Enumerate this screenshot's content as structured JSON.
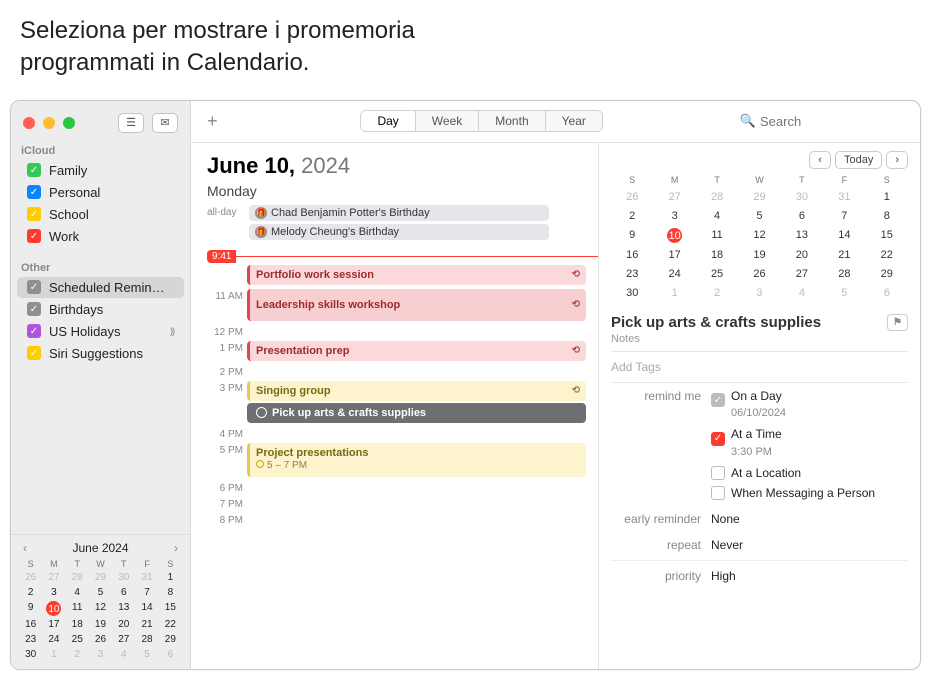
{
  "caption": "Seleziona per mostrare i promemoria programmati in Calendario.",
  "toolbar": {
    "plus": "+",
    "views": [
      "Day",
      "Week",
      "Month",
      "Year"
    ],
    "active_view": "Day",
    "search_placeholder": "Search"
  },
  "sidebar": {
    "section1": "iCloud",
    "items1": [
      {
        "label": "Family",
        "color": "#34c759"
      },
      {
        "label": "Personal",
        "color": "#0a84ff"
      },
      {
        "label": "School",
        "color": "#ffcc00"
      },
      {
        "label": "Work",
        "color": "#ff3b30"
      }
    ],
    "section2": "Other",
    "items2": [
      {
        "label": "Scheduled Remin…",
        "color": "#8e8e93",
        "selected": true
      },
      {
        "label": "Birthdays",
        "color": "#8e8e93"
      },
      {
        "label": "US Holidays",
        "color": "#af52de",
        "broadcast": true
      },
      {
        "label": "Siri Suggestions",
        "color": "#ffcc00"
      }
    ]
  },
  "smallcal": {
    "title": "June 2024",
    "dow": [
      "S",
      "M",
      "T",
      "W",
      "T",
      "F",
      "S"
    ],
    "days": [
      [
        26,
        27,
        28,
        29,
        30,
        31,
        1
      ],
      [
        2,
        3,
        4,
        5,
        6,
        7,
        8
      ],
      [
        9,
        10,
        11,
        12,
        13,
        14,
        15
      ],
      [
        16,
        17,
        18,
        19,
        20,
        21,
        22
      ],
      [
        23,
        24,
        25,
        26,
        27,
        28,
        29
      ],
      [
        30,
        1,
        2,
        3,
        4,
        5,
        6
      ]
    ],
    "today": 10,
    "dot": 4
  },
  "day": {
    "title_strong": "June 10,",
    "title_year": " 2024",
    "weekday": "Monday",
    "allday_label": "all-day",
    "birthdays": [
      "Chad Benjamin Potter's Birthday",
      "Melody Cheung's Birthday"
    ],
    "now": "9:41",
    "events": {
      "e1": "Portfolio work session",
      "e2": "Leadership skills workshop",
      "e3": "Presentation prep",
      "e4": "Singing group",
      "e5": "Pick up arts & crafts supplies",
      "e6": "Project presentations",
      "e6sub": "5 – 7 PM"
    },
    "hours": {
      "h11": "11 AM",
      "h12": "12 PM",
      "h1": "1 PM",
      "h2": "2 PM",
      "h3": "3 PM",
      "h4": "4 PM",
      "h5": "5 PM",
      "h6": "6 PM",
      "h7": "7 PM",
      "h8": "8 PM"
    }
  },
  "mini2": {
    "dow": [
      "S",
      "M",
      "T",
      "W",
      "T",
      "F",
      "S"
    ],
    "days": [
      [
        26,
        27,
        28,
        29,
        30,
        31,
        1
      ],
      [
        2,
        3,
        4,
        5,
        6,
        7,
        8
      ],
      [
        9,
        10,
        11,
        12,
        13,
        14,
        15
      ],
      [
        16,
        17,
        18,
        19,
        20,
        21,
        22
      ],
      [
        23,
        24,
        25,
        26,
        27,
        28,
        29
      ],
      [
        30,
        1,
        2,
        3,
        4,
        5,
        6
      ]
    ],
    "today": 10
  },
  "inspector": {
    "today_btn": "Today",
    "title": "Pick up arts & crafts supplies",
    "notes": "Notes",
    "addtags": "Add Tags",
    "remind_label": "remind me",
    "onday": "On a Day",
    "onday_date": "06/10/2024",
    "attime": "At a Time",
    "attime_time": "3:30 PM",
    "atloc": "At a Location",
    "whenmsg": "When Messaging a Person",
    "early_label": "early reminder",
    "early_val": "None",
    "repeat_label": "repeat",
    "repeat_val": "Never",
    "priority_label": "priority",
    "priority_val": "High"
  }
}
